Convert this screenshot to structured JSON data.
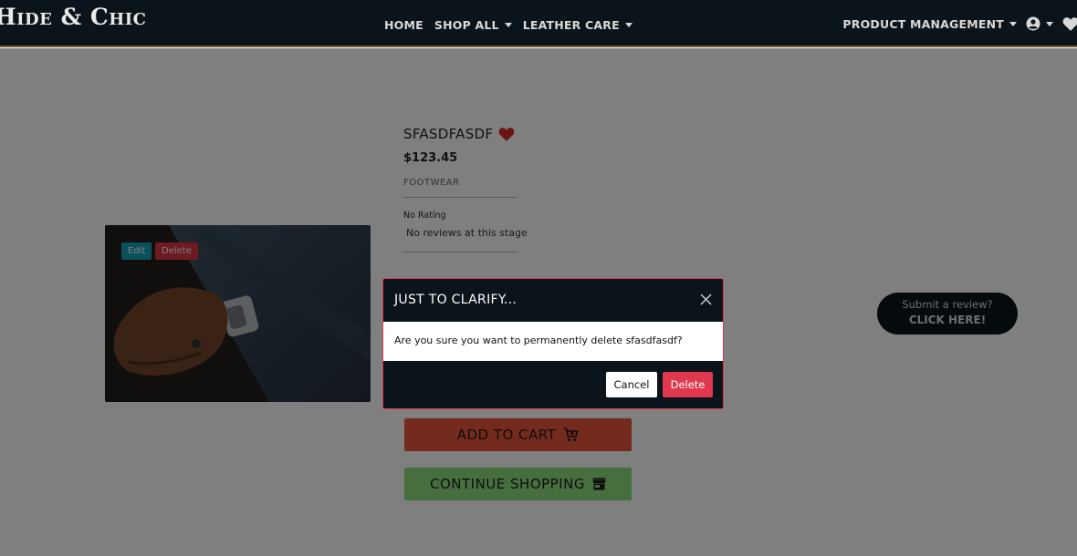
{
  "nav": {
    "brand": "Hide & Chic",
    "home": "HOME",
    "shop_all": "SHOP ALL",
    "leather_care": "LEATHER CARE",
    "product_management": "PRODUCT MANAGEMENT"
  },
  "image_buttons": {
    "edit": "Edit",
    "delete": "Delete"
  },
  "product": {
    "title": "SFASDFASDF",
    "price": "$123.45",
    "category": "FOOTWEAR",
    "rating": "No Rating",
    "reviews": "No reviews at this stage"
  },
  "actions": {
    "add_to_cart": "ADD TO CART",
    "continue_shopping": "CONTINUE SHOPPING"
  },
  "review_cta": {
    "line1": "Submit a review?",
    "line2": "CLICK HERE!"
  },
  "modal": {
    "title": "JUST TO CLARIFY...",
    "message": "Are you sure you want to permanently delete sfasdfasdf?",
    "cancel": "Cancel",
    "delete": "Delete"
  },
  "colors": {
    "nav_bg": "#0b141a",
    "accent_red": "#e0394f",
    "cart": "#e8543a",
    "shop": "#8fdc7f",
    "edit": "#17a2b8",
    "heart": "#d62828"
  }
}
